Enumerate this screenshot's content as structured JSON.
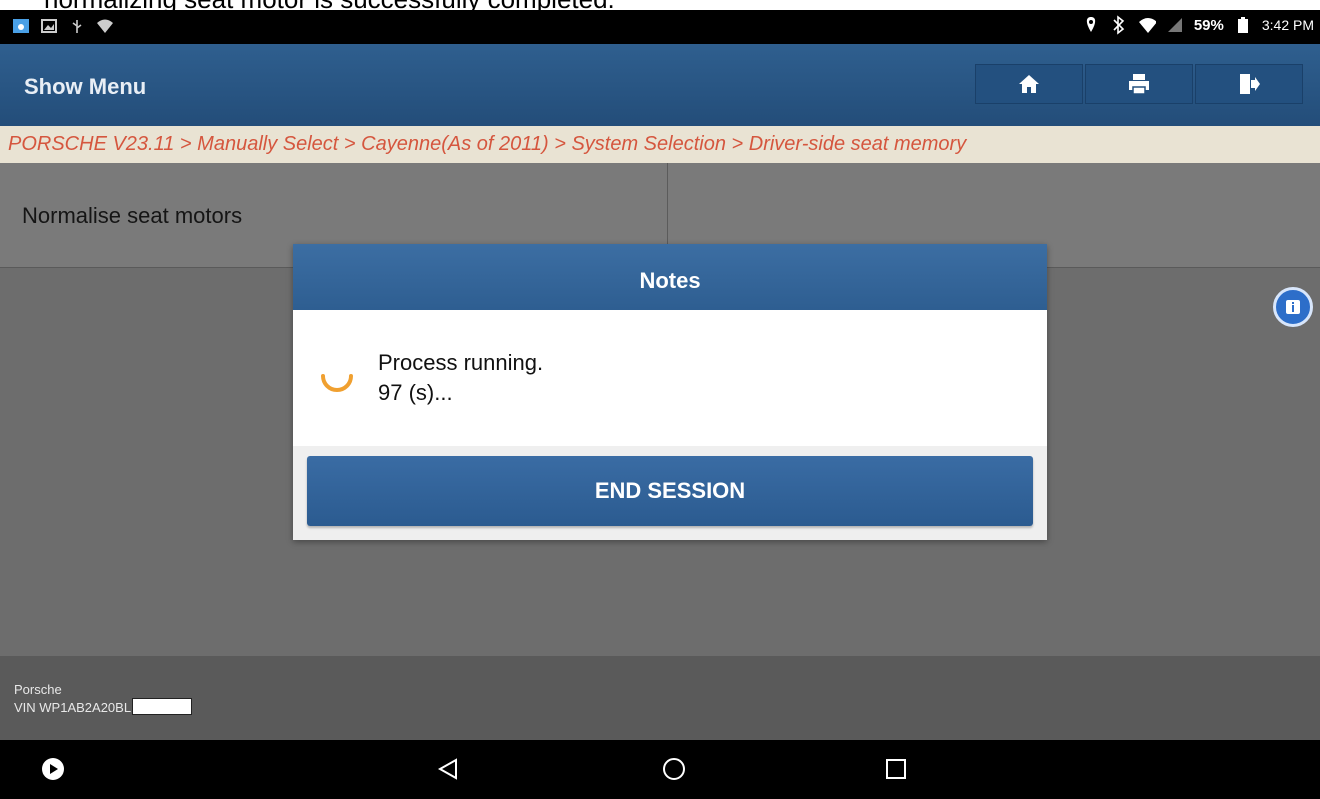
{
  "caption": "normalizing seat motor is successfully completed.",
  "status_bar": {
    "battery": "59%",
    "time": "3:42 PM"
  },
  "header": {
    "title": "Show Menu"
  },
  "breadcrumb": "PORSCHE V23.11 > Manually Select > Cayenne(As of 2011) > System Selection > Driver-side seat memory",
  "main": {
    "row_label": "Normalise seat motors"
  },
  "dialog": {
    "title": "Notes",
    "message_line1": "Process running.",
    "message_line2": "97 (s)...",
    "button": "END SESSION"
  },
  "footer": {
    "brand": "Porsche",
    "vin": "VIN WP1AB2A20BL"
  },
  "colors": {
    "appbar": "#2f5f8f",
    "breadcrumb_text": "#d5563e",
    "spinner": "#f0a030",
    "button": "#3a6ca4"
  }
}
